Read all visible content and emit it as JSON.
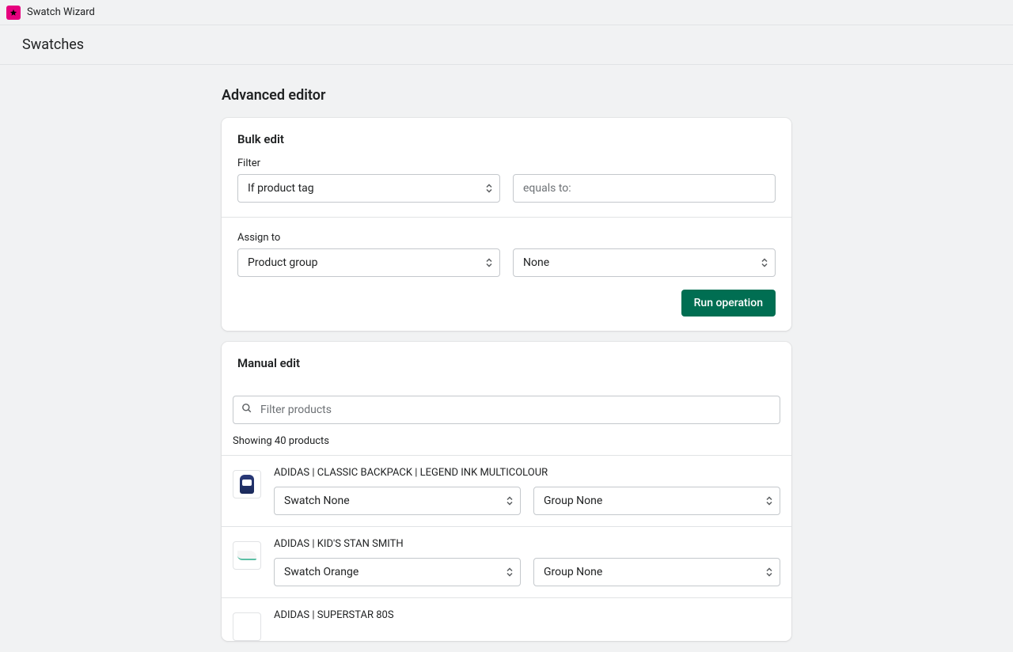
{
  "header": {
    "app_name": "Swatch Wizard",
    "page_title": "Swatches"
  },
  "section_title": "Advanced editor",
  "bulk_edit": {
    "title": "Bulk edit",
    "filter_label": "Filter",
    "filter_select": "If product tag",
    "filter_input_placeholder": "equals to:",
    "assign_label": "Assign to",
    "assign_select": "Product group",
    "assign_value": "None",
    "run_button": "Run operation"
  },
  "manual_edit": {
    "title": "Manual edit",
    "search_placeholder": "Filter products",
    "result_count": "Showing 40 products",
    "swatch_prefix": "Swatch ",
    "group_prefix": "Group ",
    "products": [
      {
        "name": "ADIDAS | CLASSIC BACKPACK | LEGEND INK MULTICOLOUR",
        "swatch": "None",
        "group": "None",
        "thumb": "backpack"
      },
      {
        "name": "ADIDAS | KID'S STAN SMITH",
        "swatch": "Orange",
        "group": "None",
        "thumb": "shoe"
      },
      {
        "name": "ADIDAS | SUPERSTAR 80S",
        "swatch": "",
        "group": "",
        "thumb": ""
      }
    ]
  }
}
